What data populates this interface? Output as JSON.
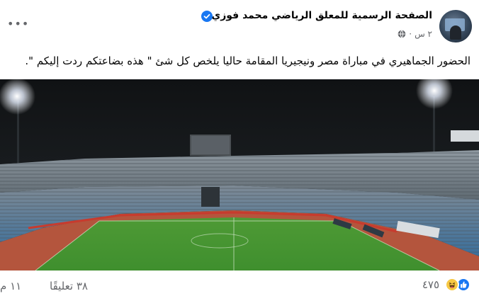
{
  "post": {
    "page_name": "الصفحة الرسمية للمعلق الرياضي محمد فوزي",
    "time": "٢ س",
    "separator": "·",
    "text": "الحضور الجماهيري في مباراة مصر ونيجيريا المقامة حاليا يلخص كل شئ \" هذه بضاعتكم ردت إليكم \".",
    "image_icon": "stadium-photo"
  },
  "footer": {
    "reaction_count": "٤٧٥",
    "comments": "٣٨ تعليقًا",
    "shares": "١١ م"
  },
  "icons": {
    "verified": "verified-badge-icon",
    "privacy": "globe-icon",
    "more": "more-options-icon",
    "like": "like-icon",
    "haha": "haha-icon"
  },
  "colors": {
    "facebook_blue": "#1877f2",
    "secondary_text": "#65676b",
    "pitch_green": "#3f8f2e",
    "track_red": "#b4553d"
  }
}
